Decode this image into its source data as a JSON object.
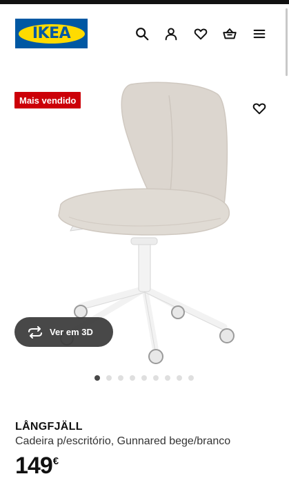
{
  "header": {
    "logo_text": "IKEA",
    "icons": [
      "search-icon",
      "user-icon",
      "heart-icon",
      "basket-icon",
      "menu-icon"
    ]
  },
  "product": {
    "badge": "Mais vendido",
    "view_3d_label": "Ver em 3D",
    "gallery": {
      "total_images": 9,
      "active_index": 0
    },
    "name": "LÅNGFJÄLL",
    "description": "Cadeira p/escritório, Gunnared bege/branco",
    "price": {
      "amount": "149",
      "currency": "€"
    }
  },
  "colors": {
    "ikea_blue": "#0058a3",
    "ikea_yellow": "#ffdb00",
    "badge_red": "#cc0008",
    "chair_fabric": "#dcd6cf",
    "chair_frame": "#f4f4f4"
  }
}
